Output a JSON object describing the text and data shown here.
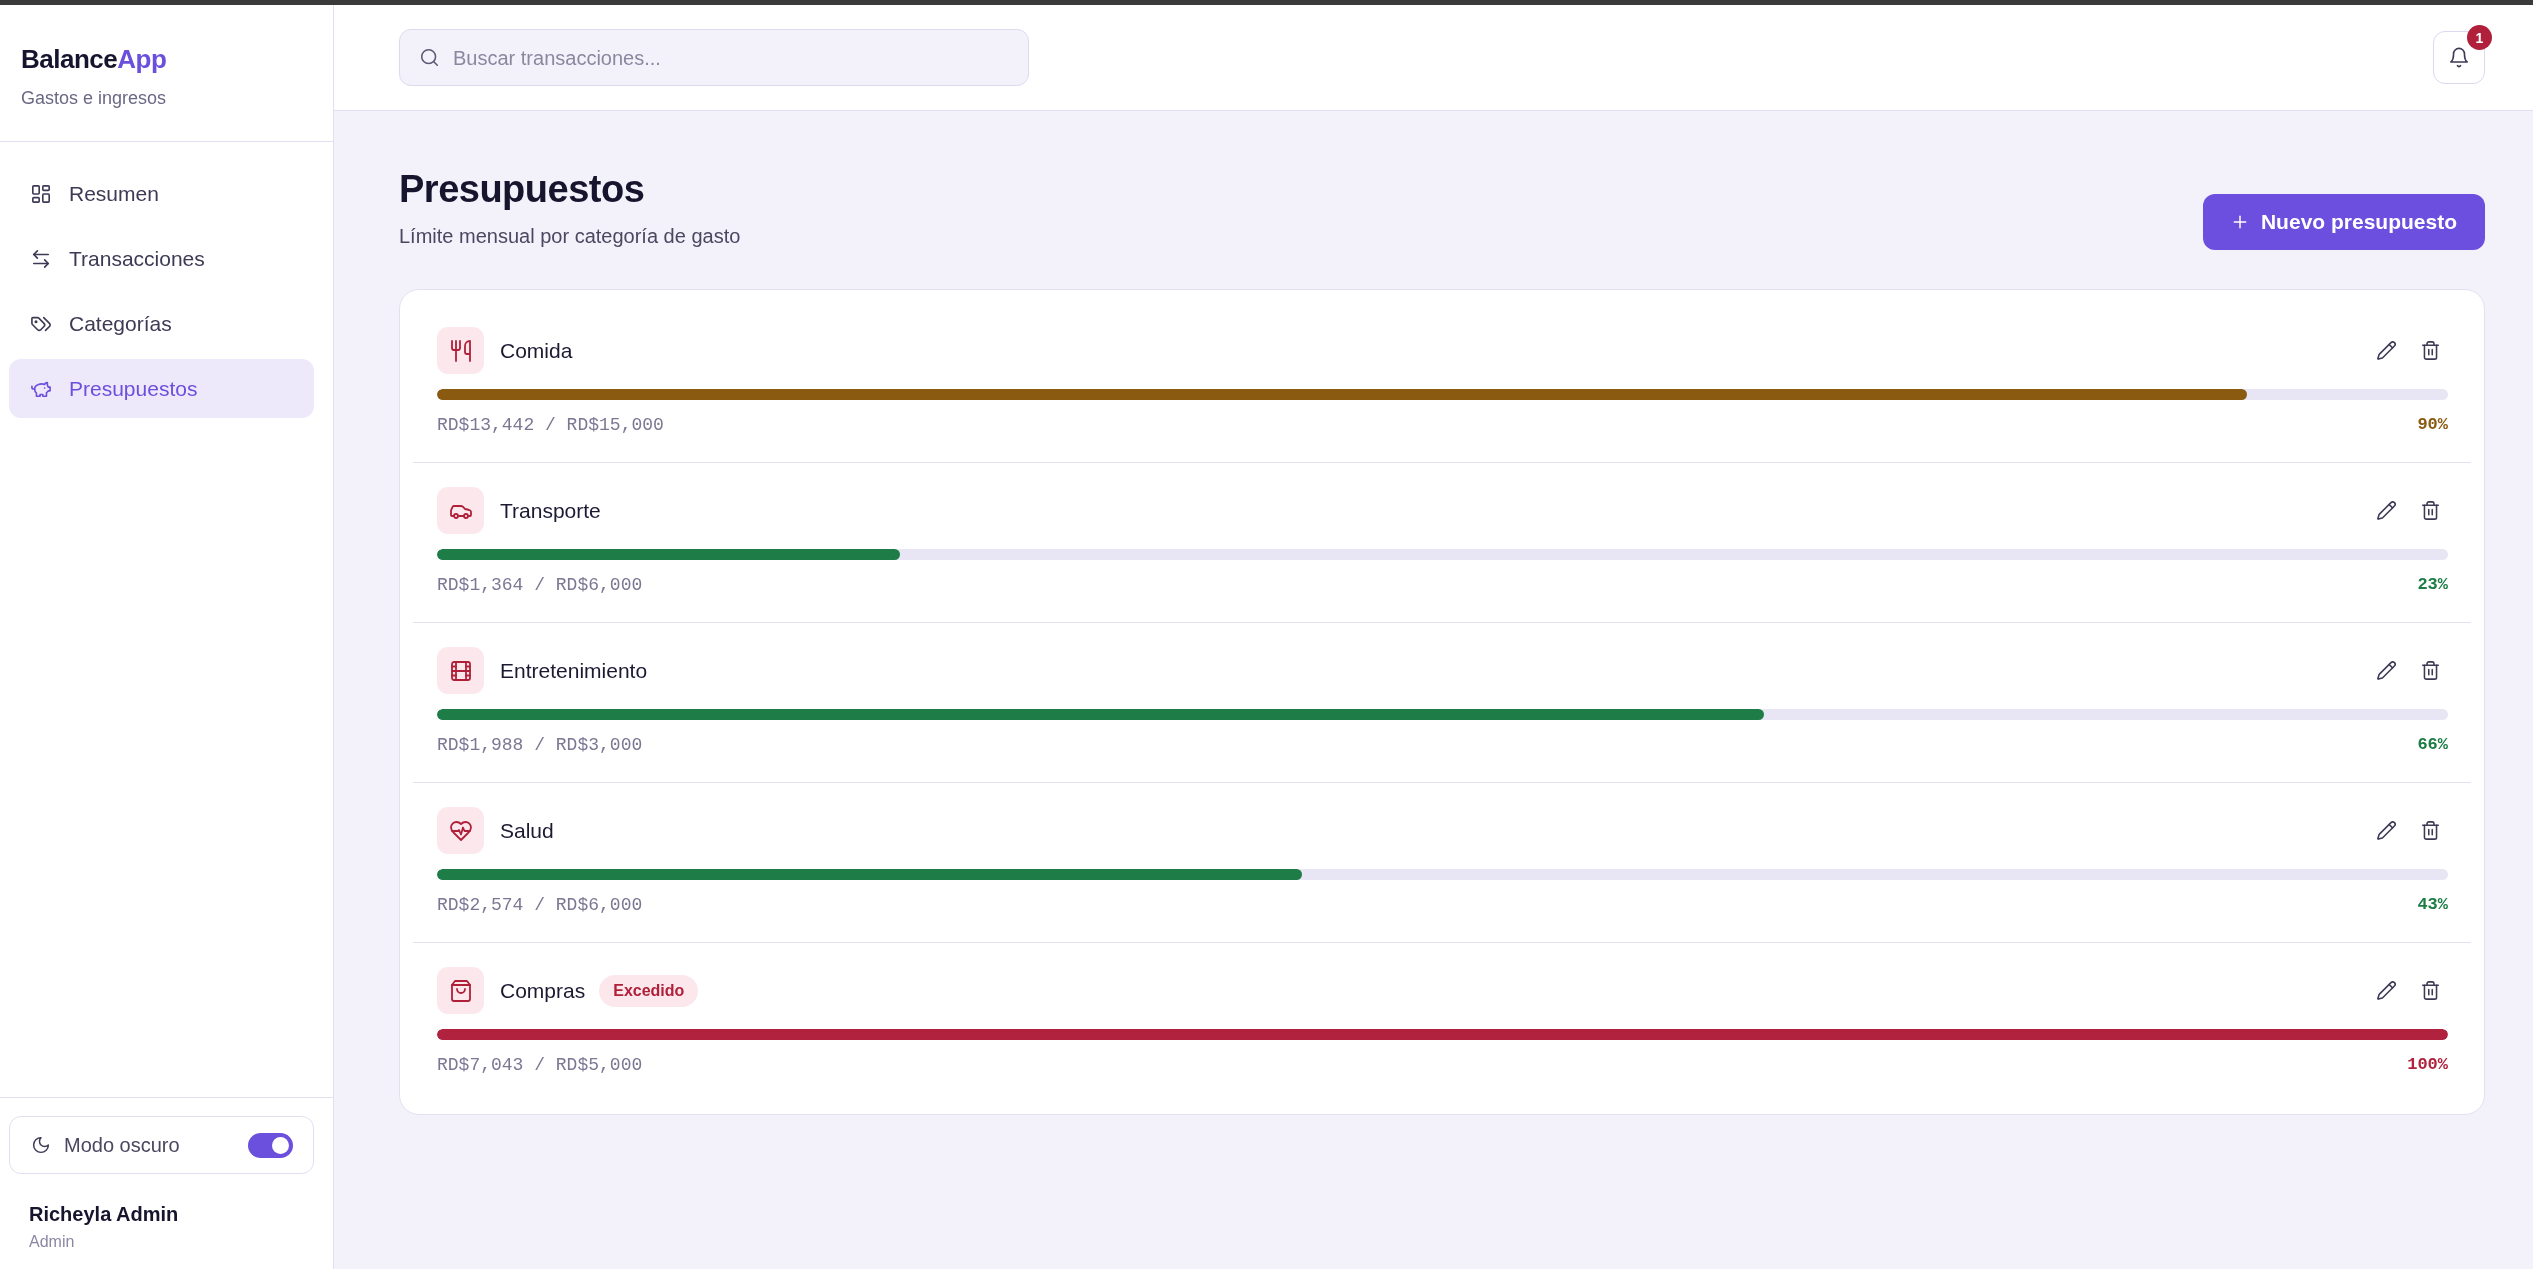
{
  "sidebar": {
    "logo": {
      "text": "Balance",
      "accent": "App"
    },
    "subtitle": "Gastos e ingresos",
    "items": [
      {
        "label": "Resumen",
        "selected": false
      },
      {
        "label": "Transacciones",
        "selected": false
      },
      {
        "label": "Categorías",
        "selected": false
      },
      {
        "label": "Presupuestos",
        "selected": true
      }
    ],
    "dark_mode": {
      "label": "Modo oscuro",
      "on": true
    },
    "user": {
      "name": "Richeyla Admin",
      "role": "Admin"
    }
  },
  "header": {
    "search": {
      "placeholder": "Buscar transacciones..."
    },
    "notifications": {
      "count": "1"
    }
  },
  "page": {
    "title": "Presupuestos",
    "subtitle": "Límite mensual por categoría de gasto",
    "new_button": "Nuevo presupuesto"
  },
  "budgets": [
    {
      "name": "Comida",
      "amounts": "RD$13,442 / RD$15,000",
      "percent": "90%",
      "level": 0.9,
      "color": "#8a5a10"
    },
    {
      "name": "Transporte",
      "amounts": "RD$1,364 / RD$6,000",
      "percent": "23%",
      "level": 0.23,
      "color": "#1e7d46"
    },
    {
      "name": "Entretenimiento",
      "amounts": "RD$1,988 / RD$3,000",
      "percent": "66%",
      "level": 0.66,
      "color": "#1e7d46"
    },
    {
      "name": "Salud",
      "amounts": "RD$2,574 / RD$6,000",
      "percent": "43%",
      "level": 0.43,
      "color": "#1e7d46"
    },
    {
      "name": "Compras",
      "badge": "Excedido",
      "amounts": "RD$7,043 / RD$5,000",
      "percent": "100%",
      "level": 1,
      "color": "#b0223d"
    }
  ]
}
